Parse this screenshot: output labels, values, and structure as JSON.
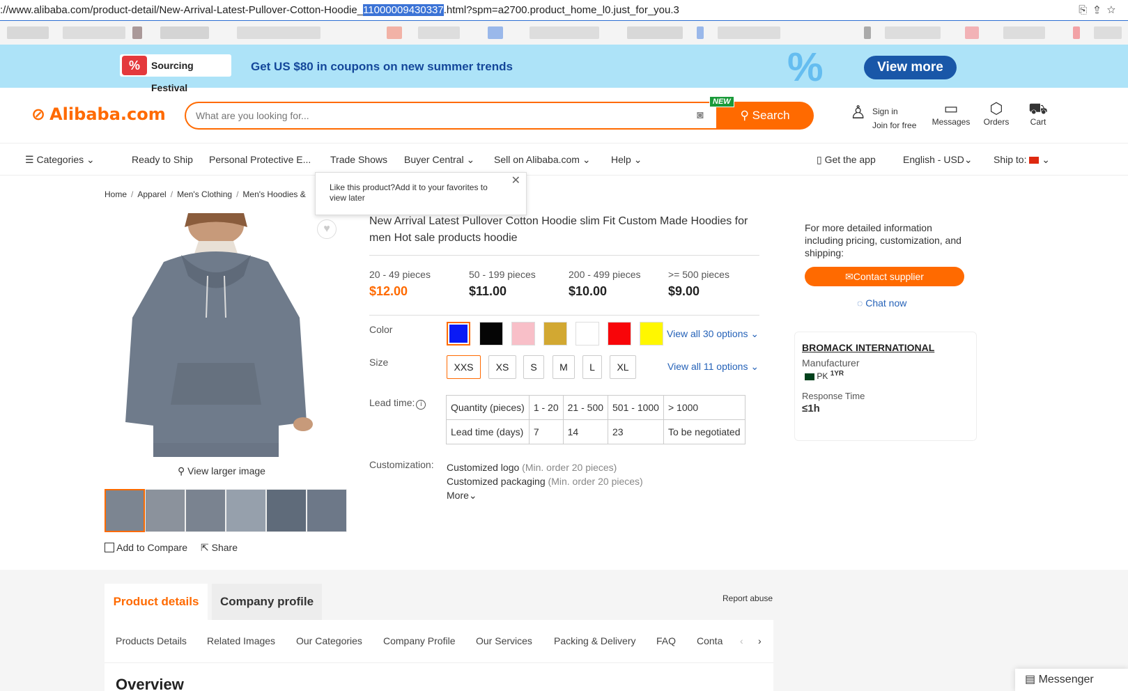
{
  "browser": {
    "url_prefix": "://www.alibaba.com/product-detail/New-Arrival-Latest-Pullover-Cotton-Hoodie_",
    "url_selected": "11000009430337",
    "url_suffix": ".html?spm=a2700.product_home_l0.just_for_you.3"
  },
  "promo": {
    "badge_text": "Sourcing Festival",
    "badge_pct": "%",
    "headline": "Get US $80 in coupons on new summer trends",
    "cta": "View more"
  },
  "header": {
    "logo": "Alibaba.com",
    "search_placeholder": "What are you looking for...",
    "new_tag": "NEW",
    "search_button": "Search",
    "sign_in": "Sign in",
    "join": "Join for free",
    "messages": "Messages",
    "orders": "Orders",
    "cart": "Cart"
  },
  "nav": {
    "categories": "Categories",
    "items": [
      "Ready to Ship",
      "Personal Protective E...",
      "Trade Shows",
      "Buyer Central",
      "Sell on Alibaba.com",
      "Help"
    ],
    "get_app": "Get the app",
    "language": "English - USD",
    "ship_to": "Ship to:"
  },
  "breadcrumb": [
    "Home",
    "Apparel",
    "Men's Clothing",
    "Men's Hoodies &"
  ],
  "tooltip": {
    "text": "Like this product?Add it to your favorites to view later"
  },
  "gallery": {
    "view_larger": "View larger image",
    "add_to_compare": "Add to Compare",
    "share": "Share"
  },
  "product": {
    "title": "New Arrival Latest Pullover Cotton Hoodie slim Fit Custom Made Hoodies for men Hot sale products hoodie",
    "prices": [
      {
        "qty": "20 - 49 pieces",
        "price": "$12.00"
      },
      {
        "qty": "50 - 199 pieces",
        "price": "$11.00"
      },
      {
        "qty": "200 - 499 pieces",
        "price": "$10.00"
      },
      {
        "qty": ">= 500 pieces",
        "price": "$9.00"
      }
    ],
    "color_label": "Color",
    "colors": [
      "#0a1af5",
      "#050505",
      "#f8bfc8",
      "#d2a832",
      "#ffffff",
      "#f80509",
      "#fff700"
    ],
    "colors_view_all": "View all 30 options",
    "size_label": "Size",
    "sizes": [
      "XXS",
      "XS",
      "S",
      "M",
      "L",
      "XL"
    ],
    "sizes_view_all": "View all 11 options",
    "lead_label": "Lead time:",
    "lead_table": {
      "row1": [
        "Quantity (pieces)",
        "1 - 20",
        "21 - 500",
        "501 - 1000",
        "> 1000"
      ],
      "row2": [
        "Lead time (days)",
        "7",
        "14",
        "23",
        "To be negotiated"
      ]
    },
    "custom_label": "Customization:",
    "custom_logo": "Customized logo",
    "custom_logo_note": "(Min. order 20 pieces)",
    "custom_packaging": "Customized packaging",
    "custom_packaging_note": "(Min. order 20 pieces)",
    "more": "More"
  },
  "supplier": {
    "info_text": "For more detailed information including pricing, customization, and shipping:",
    "contact_button": "Contact supplier",
    "chat_now": "Chat now",
    "company_name": "BROMACK INTERNATIONAL",
    "company_type": "Manufacturer",
    "country": "PK",
    "years": "1YR",
    "response_label": "Response Time",
    "response_value": "≤1h"
  },
  "details": {
    "tab_active": "Product details",
    "tab_inactive": "Company profile",
    "report": "Report abuse",
    "subnav": [
      "Products Details",
      "Related Images",
      "Our Categories",
      "Company Profile",
      "Our Services",
      "Packing & Delivery",
      "FAQ",
      "Conta"
    ],
    "overview": "Overview"
  },
  "messenger": "Messenger"
}
